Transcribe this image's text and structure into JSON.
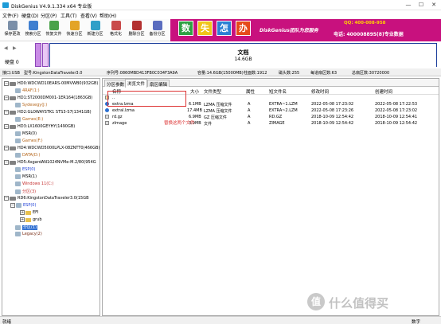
{
  "window": {
    "title": "DiskGenius V4.9.1.334 x64 专业版",
    "controls": [
      "—",
      "☐",
      "✕"
    ]
  },
  "menu": [
    "文件(F)",
    "硬盘(D)",
    "分区(P)",
    "工具(T)",
    "查看(V)",
    "帮助(H)"
  ],
  "toolbar": [
    {
      "label": "保存更改",
      "color": "#7b8fa8"
    },
    {
      "label": "搜索分区",
      "color": "#3f7fd0"
    },
    {
      "label": "恢复文件",
      "color": "#4aa24a"
    },
    {
      "label": "快速分区",
      "color": "#e3a427"
    },
    {
      "label": "新建分区",
      "color": "#2fa0c8"
    },
    {
      "label": "格式化",
      "color": "#c94a4a"
    },
    {
      "label": "删除分区",
      "color": "#b33030"
    },
    {
      "label": "备份分区",
      "color": "#5a6cbf"
    }
  ],
  "banner": {
    "chars": [
      "数",
      "失",
      "怎",
      "办"
    ],
    "char_colors": [
      "#2ea043",
      "#f0c419",
      "#2a7fd4",
      "#e64a19"
    ],
    "brand": "DiskGenius团队为您服务",
    "qq": "QQ: 400-008-958",
    "tel": "电话: 400008895(8)专业数据"
  },
  "diskmap": {
    "disk_label": "硬盘 0",
    "partition_name": "文档",
    "partition_size": "14.6GB",
    "colors": {
      "stripe1": "#c98be6",
      "stripe2": "#e4c7f2",
      "border": "#1b3e9b"
    }
  },
  "infobar": {
    "iface": "接口:USB",
    "model": "型号:KingstonDataTraveler3.0",
    "serial": "序列号:0860MBD413FB0C034F3A9A",
    "capacity": "容量:14.6GB(15000MB)",
    "cylinders": "柱面数:1912",
    "heads": "磁头数:255",
    "sectors": "每道扇区数:63",
    "total_sectors": "总扇区数:30720000"
  },
  "tree": [
    {
      "text": "HD0:WDCWD10EARS-00MVWB0(932GB)",
      "level": 0,
      "kind": "disk",
      "color": ""
    },
    {
      "text": "4RAF(1:)",
      "level": 1,
      "kind": "part",
      "color": "orange"
    },
    {
      "text": "HD1:ST2000DM001-1ER164(1863GB)",
      "level": 0,
      "kind": "disk",
      "color": ""
    },
    {
      "text": "Sydesegy(J:)",
      "level": 1,
      "kind": "part",
      "color": "orange"
    },
    {
      "text": "HD2:GLOWAYSTK1 STS3-S7(1341GB)",
      "level": 0,
      "kind": "disk",
      "color": ""
    },
    {
      "text": "Games(E:)",
      "level": 1,
      "kind": "part",
      "color": "orange"
    },
    {
      "text": "HD3:LX1600GEYHY(1490GB)",
      "level": 0,
      "kind": "disk",
      "color": ""
    },
    {
      "text": "MSR(0)",
      "level": 1,
      "kind": "part",
      "color": ""
    },
    {
      "text": "Games(F:)",
      "level": 1,
      "kind": "part",
      "color": "orange"
    },
    {
      "text": "HD4:WDCWD5000LPLX-08ZNTT0(466GB)",
      "level": 0,
      "kind": "disk",
      "color": ""
    },
    {
      "text": "DATA(D:)",
      "level": 1,
      "kind": "part",
      "color": "orange"
    },
    {
      "text": "HD5:AsgardAN1024NVMe-M.2/80(954G",
      "level": 0,
      "kind": "disk",
      "color": ""
    },
    {
      "text": "ESP(0)",
      "level": 1,
      "kind": "part",
      "color": "blue"
    },
    {
      "text": "MSR(1)",
      "level": 1,
      "kind": "part",
      "color": ""
    },
    {
      "text": "Windows 11(C:)",
      "level": 1,
      "kind": "part",
      "color": "red"
    },
    {
      "text": "分区(3)",
      "level": 1,
      "kind": "part",
      "color": "red"
    },
    {
      "text": "RD6:KingstonDataTraveler3.0(15GB",
      "level": 0,
      "kind": "disk",
      "color": ""
    },
    {
      "text": "ESP(0)",
      "level": 1,
      "kind": "part",
      "color": "blue"
    },
    {
      "text": "EFI",
      "level": 2,
      "kind": "folder",
      "color": ""
    },
    {
      "text": "grub",
      "level": 2,
      "kind": "folder",
      "color": ""
    },
    {
      "text": "分区(1)",
      "level": 1,
      "kind": "part",
      "color": "selected"
    },
    {
      "text": "Legacy(2)",
      "level": 1,
      "kind": "part",
      "color": "darkred"
    }
  ],
  "tabs": [
    "分区参数",
    "浏览文件",
    "扇区编辑"
  ],
  "file_headers": [
    "名称",
    "大小",
    "文件类型",
    "属性",
    "短文件名",
    "修改时间",
    "创建时间"
  ],
  "files": [
    {
      "name": "..",
      "size": "",
      "type": "",
      "attr": "",
      "short": "",
      "mtime": "",
      "ctime": "",
      "icon": "up"
    },
    {
      "name": "extra.lzma",
      "size": "6.1MB",
      "type": "LZMA 压缩文件",
      "attr": "A",
      "short": "EXTRA~1.LZM",
      "mtime": "2022-05-08 17:23:02",
      "ctime": "2022-05-08 17:22:53",
      "icon": "blue"
    },
    {
      "name": "extral.lzma",
      "size": "17.4MB",
      "type": "LZMA 压缩文件",
      "attr": "A",
      "short": "EXTRA~2.LZM",
      "mtime": "2022-05-08 17:23:26",
      "ctime": "2022-05-08 17:23:02",
      "icon": "blue"
    },
    {
      "name": "rd.gz",
      "size": "6.9MB",
      "type": "GZ 压缩文件",
      "attr": "A",
      "short": "RD.GZ",
      "mtime": "2018-10-09 12:54:42",
      "ctime": "2018-10-09 12:54:41",
      "icon": "file"
    },
    {
      "name": "zImage",
      "size": "3.9MB",
      "type": "文件",
      "attr": "A",
      "short": "ZIMAGE",
      "mtime": "2018-10-09 12:54:42",
      "ctime": "2018-10-09 12:54:42",
      "icon": "file"
    }
  ],
  "annotation": "替换这两个文件",
  "status": {
    "left": "就绪",
    "right": "数字"
  },
  "watermark": {
    "logo": "值",
    "text": "什么值得买"
  }
}
